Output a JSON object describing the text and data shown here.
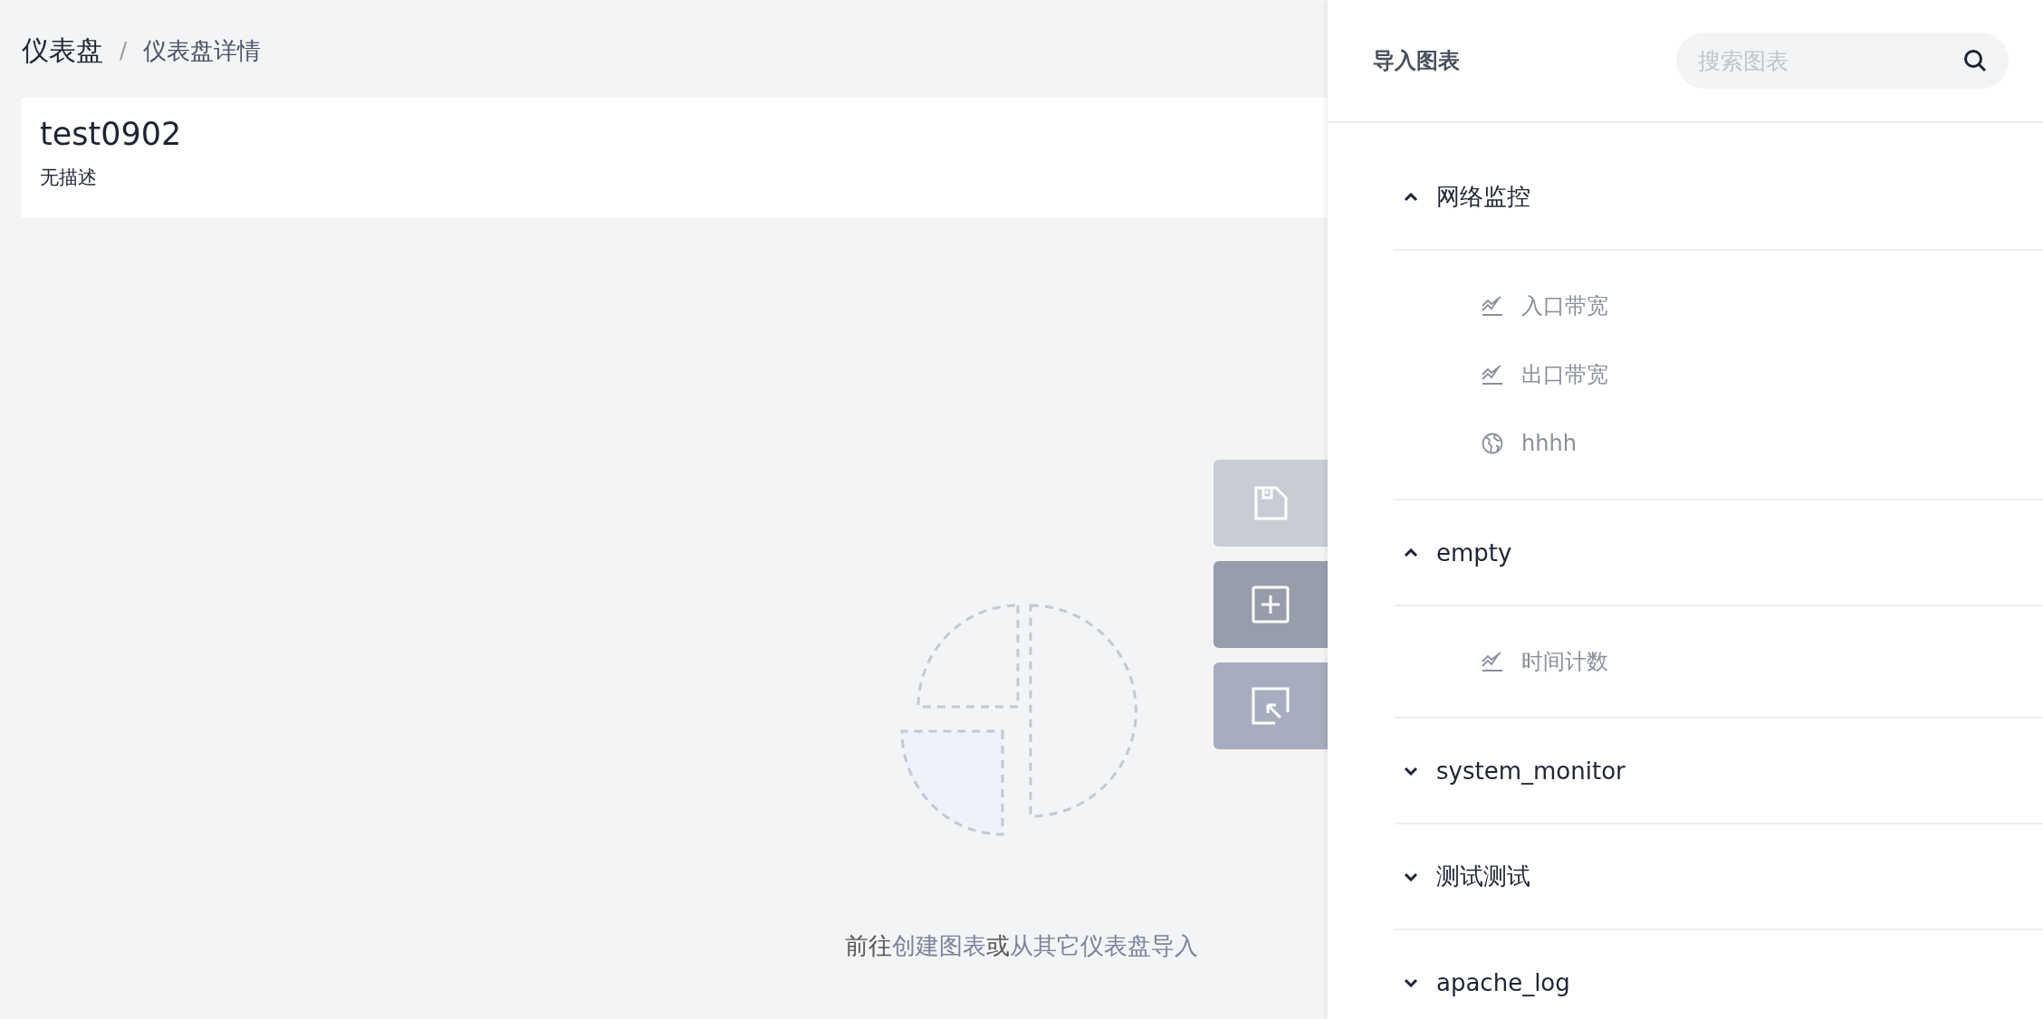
{
  "breadcrumb": {
    "items": [
      {
        "label": "仪表盘",
        "current": false
      },
      {
        "label": "仪表盘详情",
        "current": true
      }
    ],
    "separator": "/"
  },
  "dashboard": {
    "title": "test0902",
    "description": "无描述"
  },
  "empty_state": {
    "prefix": "前往",
    "create_link": "创建图表",
    "middle": "或",
    "import_link": "从其它仪表盘导入"
  },
  "action_buttons": [
    {
      "kind": "save"
    },
    {
      "kind": "add"
    },
    {
      "kind": "import"
    }
  ],
  "import_panel": {
    "title": "导入图表",
    "search": {
      "placeholder": "搜索图表"
    },
    "groups": [
      {
        "label": "网络监控",
        "expanded": true,
        "children": [
          {
            "label": "入口带宽",
            "kind": "line"
          },
          {
            "label": "出口带宽",
            "kind": "line"
          },
          {
            "label": "hhhh",
            "kind": "map"
          }
        ]
      },
      {
        "label": "empty",
        "expanded": true,
        "children": [
          {
            "label": "时间计数",
            "kind": "line"
          }
        ]
      },
      {
        "label": "system_monitor",
        "expanded": false
      },
      {
        "label": "测试测试",
        "expanded": false
      },
      {
        "label": "apache_log",
        "expanded": false
      }
    ]
  }
}
